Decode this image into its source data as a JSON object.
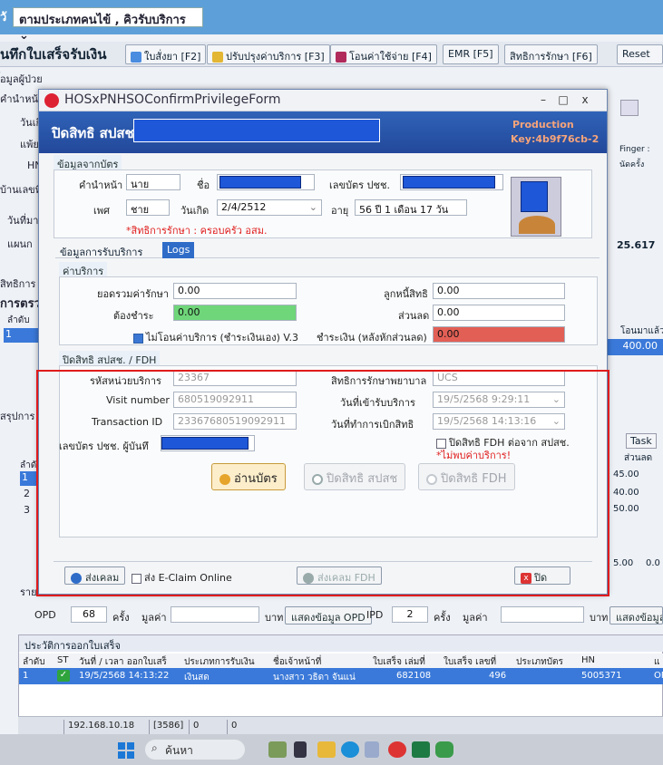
{
  "bg": {
    "title_prefix": "วั",
    "title_dropdown": "ตามประเภทคนไข้ , คิวรับบริการ",
    "toolbar_heading": "นทึกใบเสร็จรับเงิน",
    "toolbar_buttons": [
      "ใบสั่งยา [F2]",
      "ปรับปรุงค่าบริการ [F3]",
      "โอนค่าใช้จ่าย [F4]",
      "EMR [F5]",
      "สิทธิการรักษา [F6]",
      "Reset"
    ],
    "left_labels": [
      "้อมูลผู้ป่วย",
      "คำนำหน้",
      "วันเกิด",
      "แพ้ยา",
      "HN",
      "บ้านเลขที่",
      "วันที่มา",
      "แผนก",
      "สิทธิการ",
      "การตรว",
      "ลำดับ",
      "สรุปการ",
      "ลำดับ",
      "รายการ"
    ],
    "left_row_nums": [
      "1",
      "1",
      "2",
      "3"
    ],
    "right_texts": [
      "Finger :",
      "นัดครั้ง",
      "25.617",
      "โอนมาแล้ว",
      "400.00",
      "Task",
      "ส่วนลด",
      "45.00",
      "40.00",
      "50.00",
      "5.00",
      "0.0"
    ],
    "opd": {
      "opd_label": "OPD",
      "opd_count": "68",
      "times": "ครั้ง",
      "value_label": "มูลค่า",
      "baht": "บาท",
      "show_opd": "แสดงข้อมูล OPD",
      "ipd_label": "IPD",
      "ipd_count": "2",
      "times2": "ครั้ง",
      "value_label2": "มูลค่า",
      "baht2": "บาท",
      "show_ipd": "แสดงข้อมูล"
    },
    "receipt": {
      "header": "ประวัติการออกใบเสร็จ",
      "columns": [
        "ลำดับ",
        "ST",
        "วันที่ / เวลา ออกใบเสร็",
        "ประเภทการรับเงิน",
        "ชื่อเจ้าหน้าที่",
        "ใบเสร็จ เล่มที่",
        "ใบเสร็จ เลขที่",
        "ประเภทบัตร",
        "HN",
        "แ"
      ],
      "row": [
        "1",
        "",
        "19/5/2568 14:13:22",
        "เงินสด",
        "นางสาว วธิดา จันแน่",
        "682108",
        "496",
        "",
        "5005371",
        "OF"
      ]
    },
    "status": [
      "192.168.10.18",
      "[3586]",
      "0",
      "0"
    ],
    "taskbar_search": "ค้นหา"
  },
  "dialog": {
    "window_title": "HOSxPNHSOConfirmPrivilegeForm",
    "min": "–",
    "max": "□",
    "close": "x",
    "header_title": "ปิดสิทธิ สปสช",
    "production": "Production",
    "key": "Key:4b9f76cb-2",
    "card_section": "ข้อมูลจากบัตร",
    "prefix_label": "คำนำหน้า",
    "prefix_value": "นาย",
    "name_label": "ชื่อ",
    "cid_label": "เลขบัตร ปชช.",
    "sex_label": "เพศ",
    "sex_value": "ชาย",
    "dob_label": "วันเกิด",
    "dob_value": "2/4/2512",
    "age_label": "อายุ",
    "age_value": "56 ปี 1 เดือน 17 วัน",
    "privilege_note": "*สิทธิการรักษา : ครอบครัว อสม.",
    "tabs": [
      "ข้อมูลการรับบริการ",
      "Logs"
    ],
    "service_section": "ค่าบริการ",
    "total_label": "ยอดรวมค่ารักษา",
    "total_value": "0.00",
    "pay_label": "ต้องชำระ",
    "pay_value": "0.00",
    "debtor_label": "ลูกหนี้สิทธิ",
    "debtor_value": "0.00",
    "discount_label": "ส่วนลด",
    "discount_value": "0.00",
    "notransfer_label": "ไม่โอนค่าบริการ (ชำระเงินเอง) V.3",
    "paid_label": "ชำระเงิน (หลังหักส่วนลด)",
    "paid_value": "0.00",
    "fdh_section": "ปิดสิทธิ สปสช. / FDH",
    "unit_label": "รหัสหน่วยบริการ",
    "unit_value": "23367",
    "right_label": "สิทธิการรักษาพยาบาล",
    "right_value": "UCS",
    "visit_label": "Visit number",
    "visit_value": "680519092911",
    "service_date_label": "วันที่เข้ารับบริการ",
    "service_date_value": "19/5/2568 9:29:11",
    "txn_label": "Transaction ID",
    "txn_value": "23367680519092911",
    "claim_date_label": "วันที่ทำการเบิกสิทธิ",
    "claim_date_value": "19/5/2568 14:13:16",
    "doc_label": "เลขบัตร ปชช. ผู้บันทึ",
    "fdh_checkbox": "ปิดสิทธิ FDH ต่อจาก สปสช.",
    "not_found": "*ไม่พบค่าบริการ!",
    "read_card": "อ่านบัตร",
    "close_nhso": "ปิดสิทธิ สปสช",
    "close_fdh": "ปิดสิทธิ FDH",
    "send_claim": "ส่งเคลม",
    "eclaim_online": "ส่ง E-Claim Online",
    "send_fdh": "ส่งเคลม FDH",
    "close_btn": "ปิด"
  },
  "colors": {
    "header_blue": "#2f63b8",
    "pay_green": "#6fd67a",
    "paid_red": "#e25f55",
    "annotation_red": "#e01b1b"
  }
}
